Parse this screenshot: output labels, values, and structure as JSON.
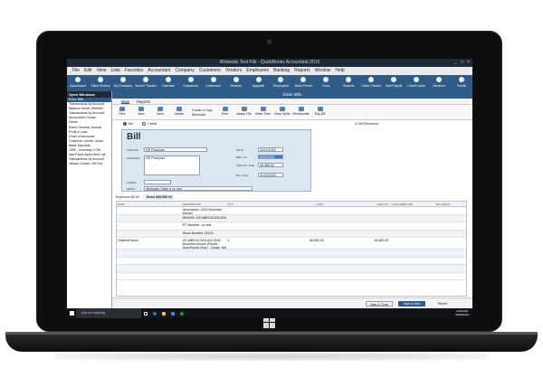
{
  "window": {
    "title": "Winbeats Test File - QuickBooks Accountant 2016",
    "controls": [
      "_",
      "□",
      "×"
    ]
  },
  "menu": [
    "File",
    "Edit",
    "View",
    "Lists",
    "Favorites",
    "Accountant",
    "Company",
    "Customers",
    "Vendors",
    "Employees",
    "Banking",
    "Reports",
    "Window",
    "Help"
  ],
  "iconbar": [
    "Accountant",
    "Client Review",
    "My Company",
    "Income Tracker",
    "Calendar",
    "Snapshots",
    "Customers",
    "Vendors",
    "Upgrade",
    "Employees",
    "Bank Feeds",
    "Docs",
    "Reports",
    "Order Checks",
    "Add Payroll",
    "Credit Cards",
    "Services",
    "Feedb"
  ],
  "open_windows": {
    "title": "Open Windows",
    "items": [
      "Enter Bills",
      "Transactions by Account",
      "Balance Sheet (Refresh",
      "Transactions by Account",
      "Accountant Center",
      "Home",
      "Entire General Journal",
      "Profit & Loss",
      "Chart of Accounts",
      "Customer Center: Acton",
      "Make Deposits",
      "1099 - Inventory 1700",
      "Add Fixed Asset Item List",
      "Transactions by Account",
      "Vendor Center: GE Flor"
    ]
  },
  "enter_bills": {
    "title": "Enter Bills",
    "tabs": [
      "Main",
      "Reports"
    ],
    "ribbon": [
      "Find",
      "New",
      "Save",
      "Delete",
      "Print",
      "Attach File",
      "Enter Time",
      "Clear Splits",
      "Recalculate",
      "Pay Bill"
    ],
    "ribbon_stack": [
      "Create a Copy",
      "Memorize"
    ],
    "radios": [
      "Bill",
      "Credit"
    ],
    "bill_received": "Bill Received",
    "form": {
      "heading": "Bill",
      "vendor_label": "VENDOR",
      "vendor": "GE Floorplan",
      "address_label": "ADDRESS",
      "address": "GE Floorplan",
      "date_label": "DATE",
      "date": "11/12/2016",
      "ref_label": "REF. NO.",
      "ref": "E0302060",
      "amount_label": "AMOUNT DUE",
      "amount": "45,580.00",
      "due_label": "BILL DUE",
      "due": "11/12/2016",
      "terms_label": "TERMS",
      "memo_label": "MEMO",
      "memo": "Winbeats Order # po test"
    },
    "detail_tabs": {
      "expenses_label": "Expenses",
      "expenses_amount": "$0.00",
      "items_label": "Items",
      "items_amount": "$45,580.00"
    },
    "grid_headers": [
      "ITEM",
      "DESCRIPTION",
      "QTY",
      "COST",
      "AMOUNT",
      "CUSTOMER:JOB",
      "BILLABLE?"
    ],
    "rows": [
      {
        "item": "",
        "description": "Description: 2016 Moomba Mondo",
        "qty": "",
        "cost": "",
        "amount": ""
      },
      {
        "item": "",
        "description": "HIN/VIN: US-MBDO1320L516",
        "qty": "",
        "cost": "",
        "amount": ""
      },
      {
        "item": "",
        "description": "PO Number: po test",
        "qty": "",
        "cost": "",
        "amount": ""
      },
      {
        "item": "",
        "description": "Stock Number: M123",
        "qty": "",
        "cost": "",
        "amount": ""
      },
      {
        "item": "Ordered Items",
        "description": "US-MBDO1320L516 2016 Moomba Mondo (Pacific Blue/Pacific Blue) - Dealer Net",
        "qty": "1",
        "cost": "45,580.00",
        "amount": "45,580.00"
      },
      {
        "item": "",
        "description": "",
        "qty": "",
        "cost": "",
        "amount": ""
      },
      {
        "item": "",
        "description": "",
        "qty": "",
        "cost": "",
        "amount": ""
      },
      {
        "item": "",
        "description": "",
        "qty": "",
        "cost": "",
        "amount": ""
      },
      {
        "item": "",
        "description": "",
        "qty": "",
        "cost": "",
        "amount": ""
      }
    ],
    "footer": {
      "save_close": "Save & Close",
      "save_new": "Save & New",
      "revert": "Revert"
    }
  },
  "taskbar": {
    "search_placeholder": "Ask me anything",
    "clock_time": "10:03 AM",
    "clock_date": "2016/11/14"
  },
  "colors": {
    "accent": "#2f5b86",
    "form_bg": "#dce6f0",
    "selection": "#3f7ac0"
  }
}
